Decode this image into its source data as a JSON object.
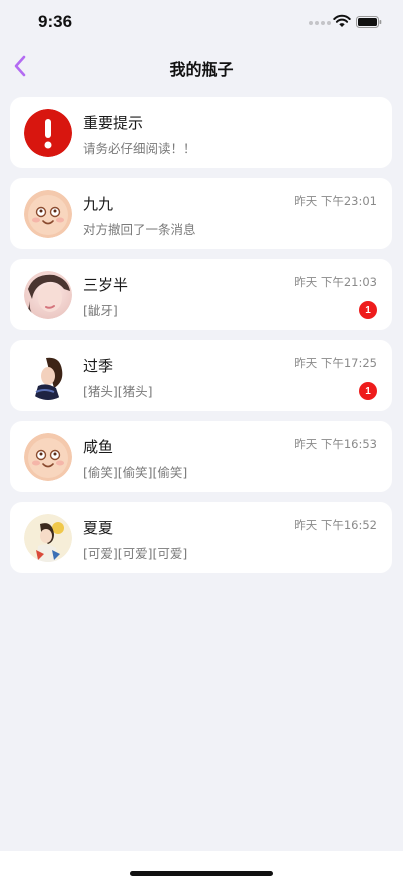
{
  "status_bar": {
    "time": "9:36"
  },
  "nav": {
    "title": "我的瓶子",
    "back_icon": "chevron-left-icon",
    "accent": "#b36bf2"
  },
  "items": [
    {
      "name": "重要提示",
      "preview": "请务必仔细阅读！！",
      "time": "",
      "badge": "",
      "avatar": "alert-icon"
    },
    {
      "name": "九九",
      "preview": "对方撤回了一条消息",
      "time": "昨天 下午23:01",
      "badge": "",
      "avatar": "smiley-face-avatar"
    },
    {
      "name": "三岁半",
      "preview": "[龇牙]",
      "time": "昨天 下午21:03",
      "badge": "1",
      "avatar": "photo-avatar"
    },
    {
      "name": "过季",
      "preview": "[猪头][猪头]",
      "time": "昨天 下午17:25",
      "badge": "1",
      "avatar": "photo-avatar"
    },
    {
      "name": "咸鱼",
      "preview": "[偷笑][偷笑][偷笑]",
      "time": "昨天 下午16:53",
      "badge": "",
      "avatar": "smiley-face-avatar"
    },
    {
      "name": "夏夏",
      "preview": "[可爱][可爱][可爱]",
      "time": "昨天 下午16:52",
      "badge": "",
      "avatar": "illustration-avatar"
    }
  ],
  "colors": {
    "background": "#f1f2f7",
    "card": "#ffffff",
    "badge": "#ee1c1c",
    "alert": "#d8160f"
  }
}
